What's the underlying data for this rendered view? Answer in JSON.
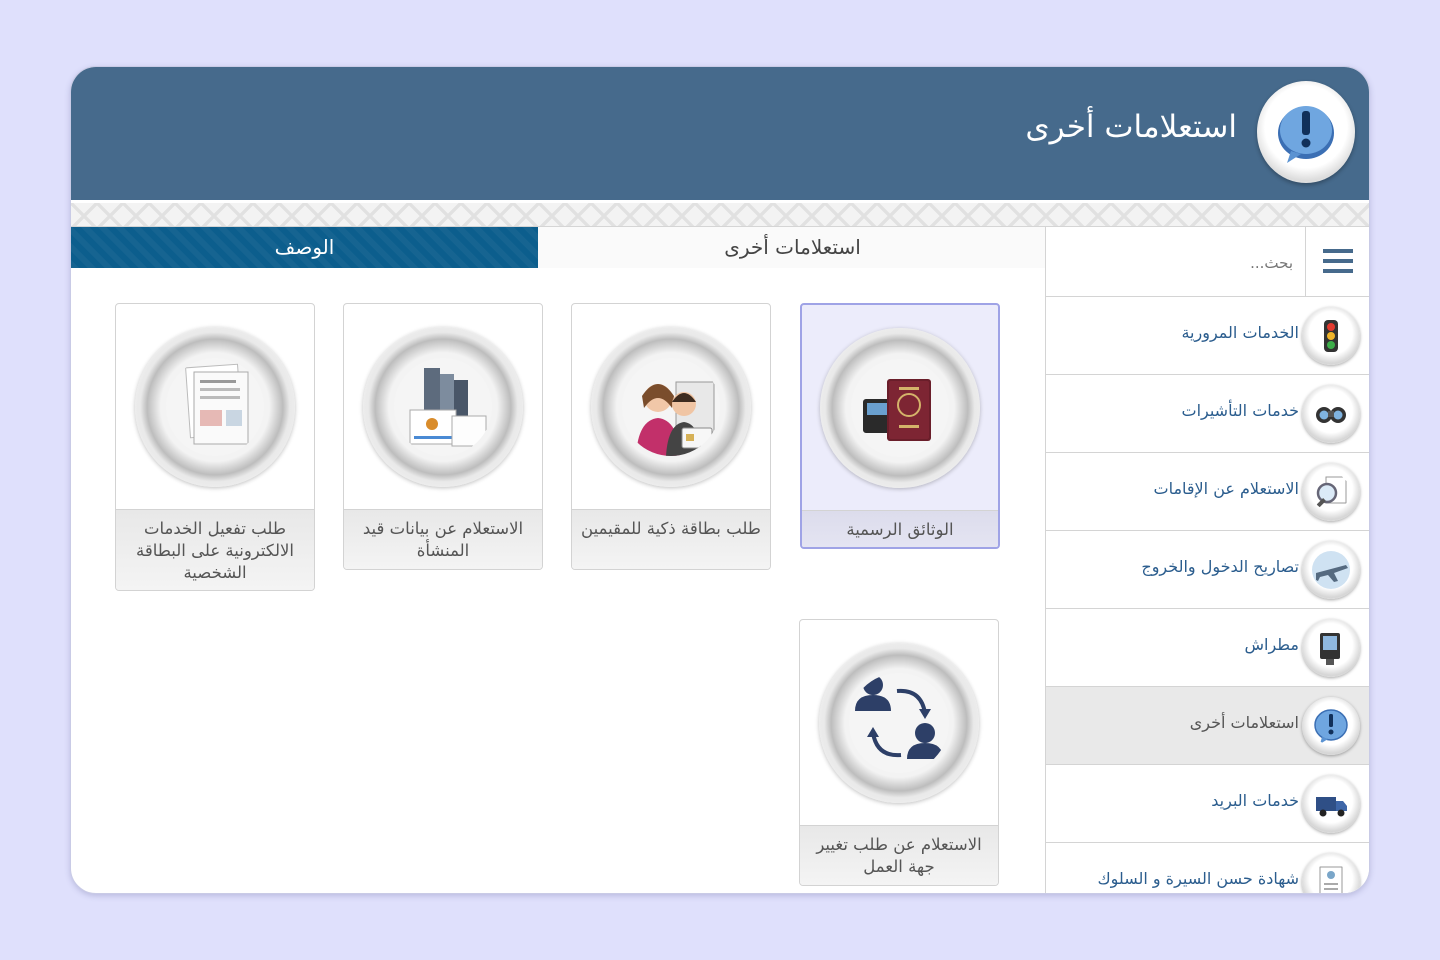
{
  "header": {
    "title": "استعلامات أخرى",
    "icon": "exclamation-bubble-icon"
  },
  "search": {
    "placeholder": "بحث..."
  },
  "sidebar": {
    "items": [
      {
        "label": "الخدمات المرورية",
        "icon": "traffic-light-icon"
      },
      {
        "label": "خدمات التأشيرات",
        "icon": "binoculars-icon"
      },
      {
        "label": "الاستعلام عن الإقامات",
        "icon": "magnifier-document-icon"
      },
      {
        "label": "تصاريح الدخول والخروج",
        "icon": "airplane-icon"
      },
      {
        "label": "مطراش",
        "icon": "kiosk-icon"
      },
      {
        "label": "استعلامات أخرى",
        "icon": "exclamation-bubble-icon",
        "active": true
      },
      {
        "label": "خدمات البريد",
        "icon": "delivery-truck-icon"
      },
      {
        "label": "شهادة حسن السيرة و السلوك",
        "icon": "certificate-icon"
      }
    ]
  },
  "tabs": {
    "current": "استعلامات أخرى",
    "description": "الوصف"
  },
  "cards": [
    {
      "label": "الوثائق الرسمية",
      "icon": "passport-icon",
      "selected": true
    },
    {
      "label": "طلب بطاقة ذكية للمقيمين",
      "icon": "resident-id-card-icon"
    },
    {
      "label": "الاستعلام عن بيانات قيد المنشأة",
      "icon": "establishment-certificate-icon"
    },
    {
      "label": "طلب تفعيل الخدمات الالكترونية على البطاقة الشخصية",
      "icon": "documents-stack-icon"
    },
    {
      "label": "الاستعلام عن طلب تغيير جهة العمل",
      "icon": "people-exchange-icon"
    }
  ],
  "colors": {
    "header": "#466a8c",
    "accent_tab": "#0c5e8d",
    "link": "#2b5d8e",
    "background": "#dfe0fc"
  }
}
